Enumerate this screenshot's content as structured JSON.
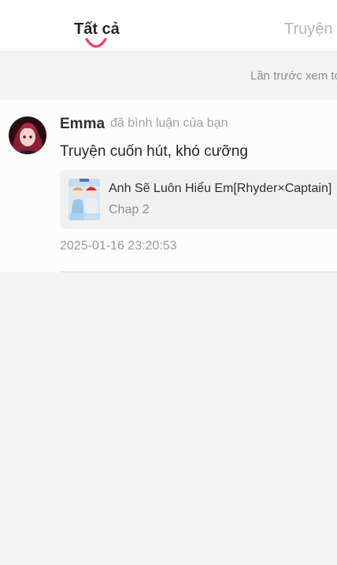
{
  "tabs": [
    {
      "label": "Tất cả",
      "active": true
    },
    {
      "label": "Truyện",
      "active": false
    }
  ],
  "colors": {
    "accent": "#e64a73",
    "background": "#f3f3f3",
    "card": "#fcfcfc"
  },
  "notice": "Lần trước xem tớ",
  "notification": {
    "user_name": "Emma",
    "action": "đã bình luận của bạn",
    "comment": "Truyện cuốn hút, khó cưỡng",
    "story": {
      "title": "Anh Sẽ Luôn Hiểu Em[Rhyder×Captain]",
      "chapter": "Chap 2"
    },
    "timestamp": "2025-01-16 23:20:53"
  }
}
